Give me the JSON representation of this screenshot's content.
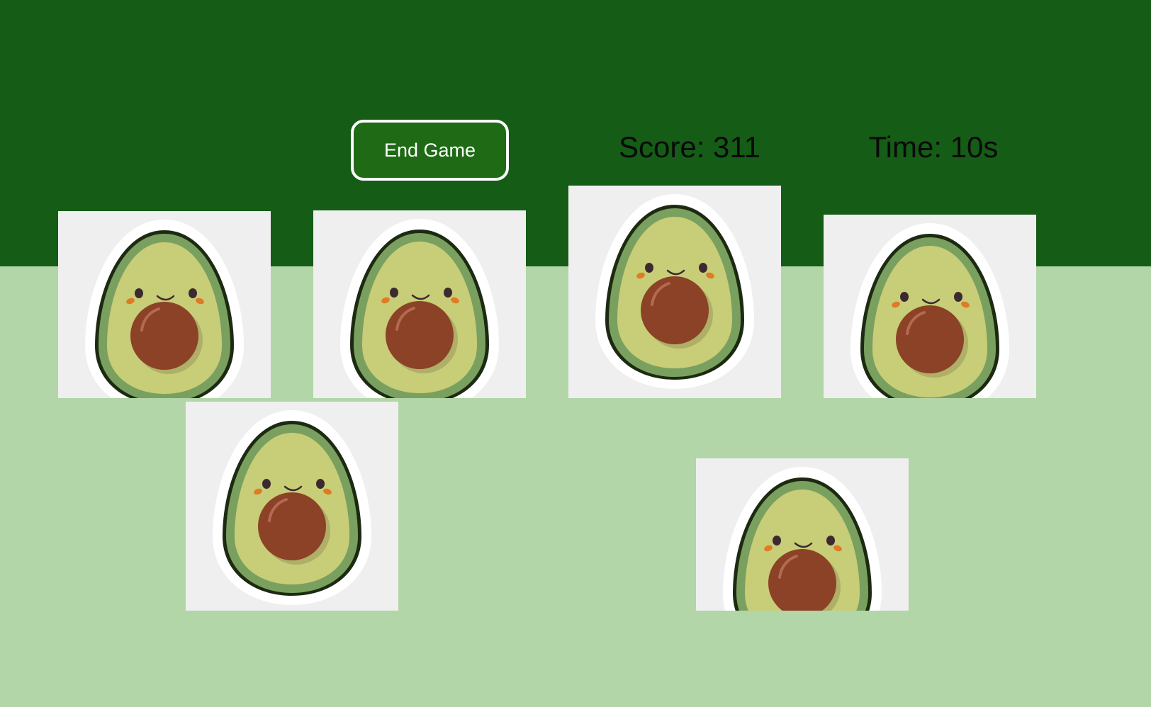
{
  "game": {
    "end_button_label": "End Game",
    "score_text": "Score: 311",
    "time_text": "Time: 10s"
  },
  "targets": {
    "icon": "avocado-icon",
    "count": 6
  },
  "colors": {
    "header_bg": "#155c16",
    "field_bg": "#b2d6a7",
    "button_bg": "#1f6a14",
    "tile_bg": "#efefef",
    "avocado_skin": "#7aa060",
    "avocado_flesh": "#c8cd78",
    "avocado_pit": "#8b4226"
  }
}
